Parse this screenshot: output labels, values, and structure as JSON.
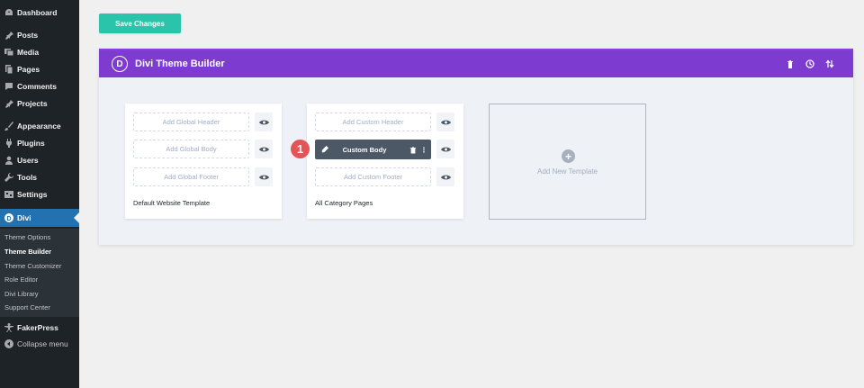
{
  "sidebar": {
    "items": [
      {
        "label": "Dashboard",
        "icon": "dashboard-icon"
      },
      {
        "label": "Posts",
        "icon": "pin-icon"
      },
      {
        "label": "Media",
        "icon": "media-icon"
      },
      {
        "label": "Pages",
        "icon": "pages-icon"
      },
      {
        "label": "Comments",
        "icon": "comment-icon"
      },
      {
        "label": "Projects",
        "icon": "pin-icon"
      },
      {
        "label": "Appearance",
        "icon": "brush-icon"
      },
      {
        "label": "Plugins",
        "icon": "plugin-icon"
      },
      {
        "label": "Users",
        "icon": "users-icon"
      },
      {
        "label": "Tools",
        "icon": "wrench-icon"
      },
      {
        "label": "Settings",
        "icon": "settings-icon"
      },
      {
        "label": "Divi",
        "icon": "divi-icon"
      },
      {
        "label": "FakerPress",
        "icon": "fakerpress-icon"
      },
      {
        "label": "Collapse menu",
        "icon": "collapse-icon"
      }
    ],
    "submenu": [
      {
        "label": "Theme Options"
      },
      {
        "label": "Theme Builder"
      },
      {
        "label": "Theme Customizer"
      },
      {
        "label": "Role Editor"
      },
      {
        "label": "Divi Library"
      },
      {
        "label": "Support Center"
      }
    ],
    "active_item": "Divi",
    "current_submenu": "Theme Builder"
  },
  "toolbar": {
    "save_label": "Save Changes"
  },
  "builder": {
    "logo_letter": "D",
    "title": "Divi Theme Builder",
    "header_icons": [
      "trash-icon",
      "history-icon",
      "import-export-icon"
    ],
    "cards": [
      {
        "header_slot": "Add Global Header",
        "body_slot": "Add Global Body",
        "footer_slot": "Add Global Footer",
        "name": "Default Website Template"
      },
      {
        "header_slot": "Add Custom Header",
        "body_slot": "Custom Body",
        "footer_slot": "Add Custom Footer",
        "name": "All Category Pages"
      }
    ],
    "step_marker": "1",
    "add_template": {
      "plus": "+",
      "label": "Add New Template"
    }
  },
  "colors": {
    "sidebar_bg": "#1d2327",
    "active_blue": "#2271b1",
    "save_green": "#29c4a9",
    "builder_purple": "#7e3bd0",
    "filled_slot": "#4c5866",
    "marker_red": "#e35457"
  }
}
